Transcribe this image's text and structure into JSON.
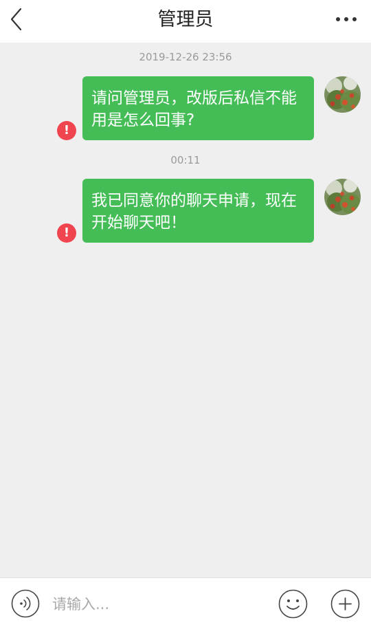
{
  "header": {
    "title": "管理员",
    "back_icon": "chevron-left-icon",
    "more_icon": "more-dots-icon"
  },
  "messages": [
    {
      "timestamp": "2019-12-26 23:56",
      "text": "请问管理员，改版后私信不能用是怎么回事?",
      "status": "failed",
      "status_glyph": "!"
    },
    {
      "timestamp": "00:11",
      "text": "我已同意你的聊天申请，现在开始聊天吧！",
      "status": "failed",
      "status_glyph": "!"
    }
  ],
  "input_bar": {
    "placeholder": "请输入...",
    "voice_icon": "voice-icon",
    "emoji_icon": "emoji-icon",
    "plus_icon": "plus-icon"
  },
  "colors": {
    "bubble": "#44bd57",
    "error": "#f0454f",
    "background": "#efefef"
  }
}
